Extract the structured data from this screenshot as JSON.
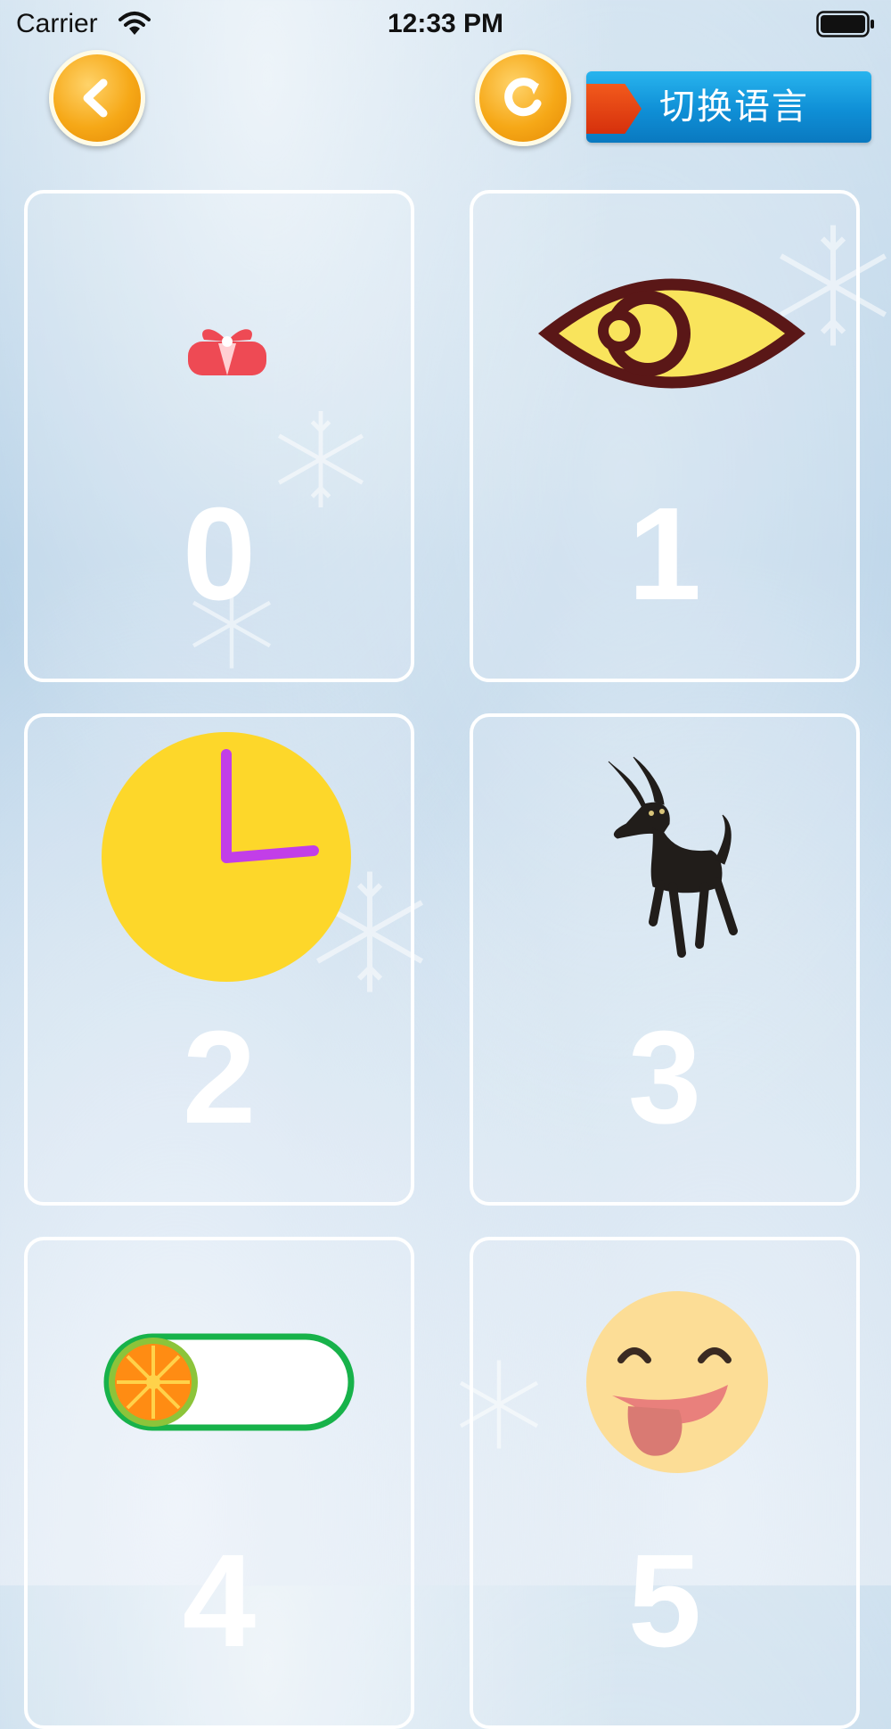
{
  "status_bar": {
    "carrier": "Carrier",
    "time": "12:33 PM"
  },
  "header": {
    "back_icon": "chevron-left-icon",
    "refresh_icon": "refresh-icon",
    "language_button_label": "切换语言"
  },
  "cards": [
    {
      "number": "0",
      "picture": "gift-icon"
    },
    {
      "number": "1",
      "picture": "eye-icon"
    },
    {
      "number": "2",
      "picture": "clock-icon"
    },
    {
      "number": "3",
      "picture": "goat-icon"
    },
    {
      "number": "4",
      "picture": "toggle-switch-icon"
    },
    {
      "number": "5",
      "picture": "tongue-emoji-icon"
    }
  ],
  "colors": {
    "button_orange": "#f6a817",
    "language_blue": "#0f8fd6",
    "clock_yellow": "#fdd72a",
    "clock_hand_purple": "#c23ee8"
  }
}
